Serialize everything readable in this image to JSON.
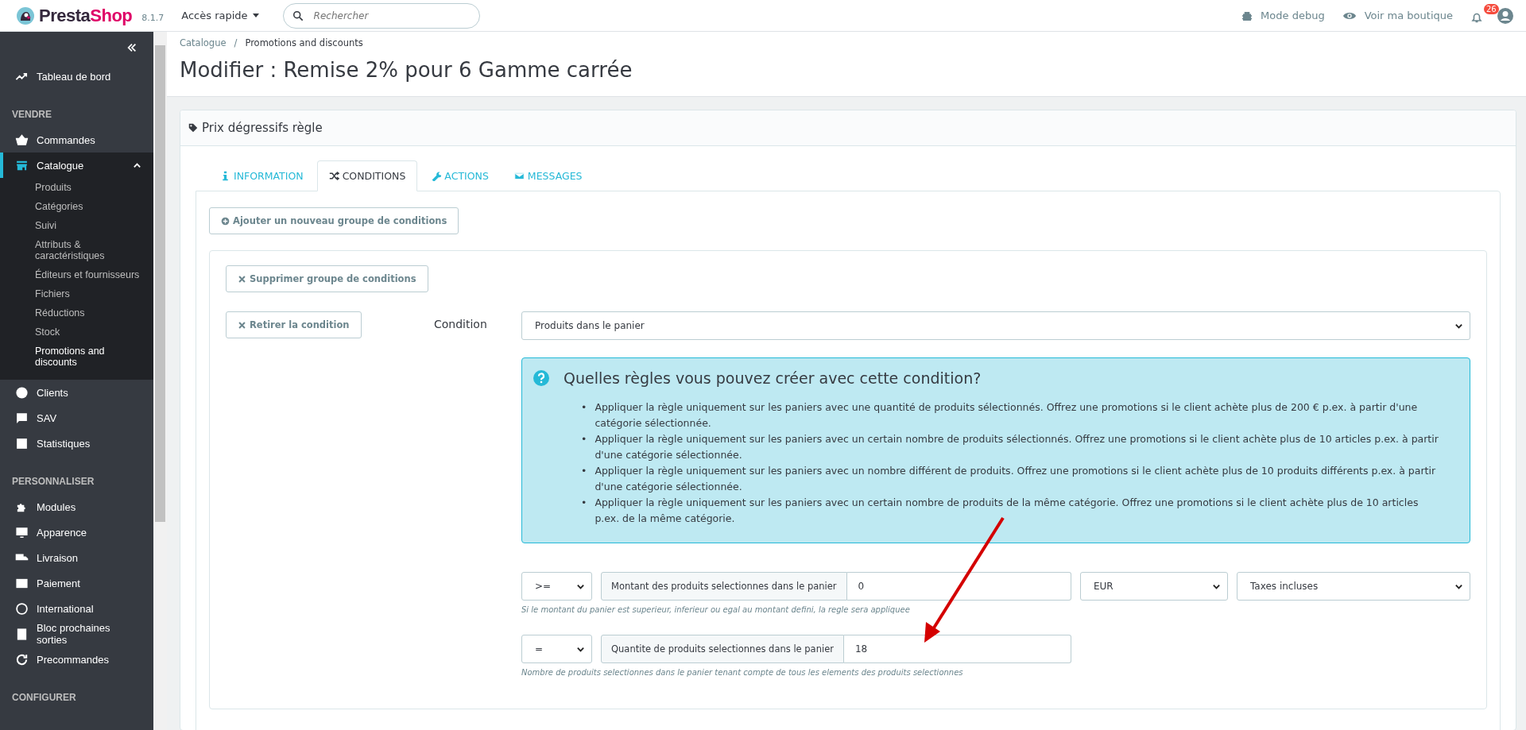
{
  "topbar": {
    "logo_first": "Presta",
    "logo_second": "Shop",
    "version": "8.1.7",
    "quick_access": "Accès rapide",
    "search": {
      "placeholder": "Rechercher"
    },
    "debug": "Mode debug",
    "shop_link": "Voir ma boutique",
    "notifications": "26"
  },
  "sidebar": {
    "items": [
      {
        "kind": "link",
        "label": "Tableau de bord",
        "selected": false
      },
      {
        "kind": "heading",
        "label": "VENDRE"
      },
      {
        "kind": "link",
        "label": "Commandes",
        "selected": false
      },
      {
        "kind": "link",
        "label": "Catalogue",
        "selected": true,
        "expanded": true,
        "children": [
          {
            "label": "Produits",
            "selected": false
          },
          {
            "label": "Catégories",
            "selected": false
          },
          {
            "label": "Suivi",
            "selected": false
          },
          {
            "label": "Attributs & caractéristiques",
            "selected": false
          },
          {
            "label": "Éditeurs et fournisseurs",
            "selected": false
          },
          {
            "label": "Fichiers",
            "selected": false
          },
          {
            "label": "Réductions",
            "selected": false
          },
          {
            "label": "Stock",
            "selected": false
          },
          {
            "label": "Promotions and discounts",
            "selected": true
          }
        ]
      },
      {
        "kind": "link",
        "label": "Clients",
        "selected": false
      },
      {
        "kind": "link",
        "label": "SAV",
        "selected": false
      },
      {
        "kind": "link",
        "label": "Statistiques",
        "selected": false
      },
      {
        "kind": "heading",
        "label": "PERSONNALISER"
      },
      {
        "kind": "link",
        "label": "Modules",
        "selected": false
      },
      {
        "kind": "link",
        "label": "Apparence",
        "selected": false
      },
      {
        "kind": "link",
        "label": "Livraison",
        "selected": false
      },
      {
        "kind": "link",
        "label": "Paiement",
        "selected": false
      },
      {
        "kind": "link",
        "label": "International",
        "selected": false
      },
      {
        "kind": "link",
        "label": "Bloc prochaines sorties",
        "selected": false
      },
      {
        "kind": "link",
        "label": "Precommandes",
        "selected": false
      },
      {
        "kind": "heading",
        "label": "CONFIGURER"
      }
    ]
  },
  "breadcrumb": {
    "items": [
      "Catalogue",
      "Promotions and discounts"
    ],
    "separator": "/"
  },
  "page_title": "Modifier : Remise 2% pour 6 Gamme carrée",
  "panel": {
    "title": "Prix dégressifs règle",
    "tabs": [
      {
        "label": "INFORMATION",
        "selected": false
      },
      {
        "label": "CONDITIONS",
        "selected": true
      },
      {
        "label": "ACTIONS",
        "selected": false
      },
      {
        "label": "MESSAGES",
        "selected": false
      }
    ],
    "add_group_button": "Ajouter un nouveau groupe de conditions",
    "delete_group_button": "Supprimer groupe de conditions",
    "remove_condition_button": "Retirer la condition",
    "condition_label": "Condition",
    "condition_value": "Produits dans le panier",
    "help": {
      "title": "Quelles règles vous pouvez créer avec cette condition?",
      "bullet": "•",
      "items": [
        "Appliquer la règle uniquement sur les paniers avec une quantité de produits sélectionnés. Offrez une promotions si le client achète plus de 200 € p.ex. à partir d'une catégorie sélectionnée.",
        "Appliquer la règle uniquement sur les paniers avec un certain nombre de produits sélectionnés. Offrez une promotions si le client achète plus de 10 articles p.ex. à partir d'une catégorie sélectionnée.",
        "Appliquer la règle uniquement sur les paniers avec un nombre différent de produits. Offrez une promotions si le client achète plus de 10 produits différents p.ex. à partir d'une catégorie sélectionnée.",
        "Appliquer la règle uniquement sur les paniers avec un certain nombre de produits de la même catégorie. Offrez une promotions si le client achète plus de 10 articles p.ex. de la même catégorie."
      ]
    },
    "rows": [
      {
        "operator": ">=",
        "label": "Montant des produits selectionnes dans le panier",
        "value": "0",
        "currency": "EUR",
        "tax": "Taxes incluses",
        "hint": "Si le montant du panier est superieur, inferieur ou egal au montant defini, la regle sera appliquee"
      },
      {
        "operator": "=",
        "label": "Quantite de produits selectionnes dans le panier",
        "value": "18",
        "hint": "Nombre de produits selectionnes dans le panier tenant compte de tous les elements des produits selectionnes"
      }
    ]
  }
}
